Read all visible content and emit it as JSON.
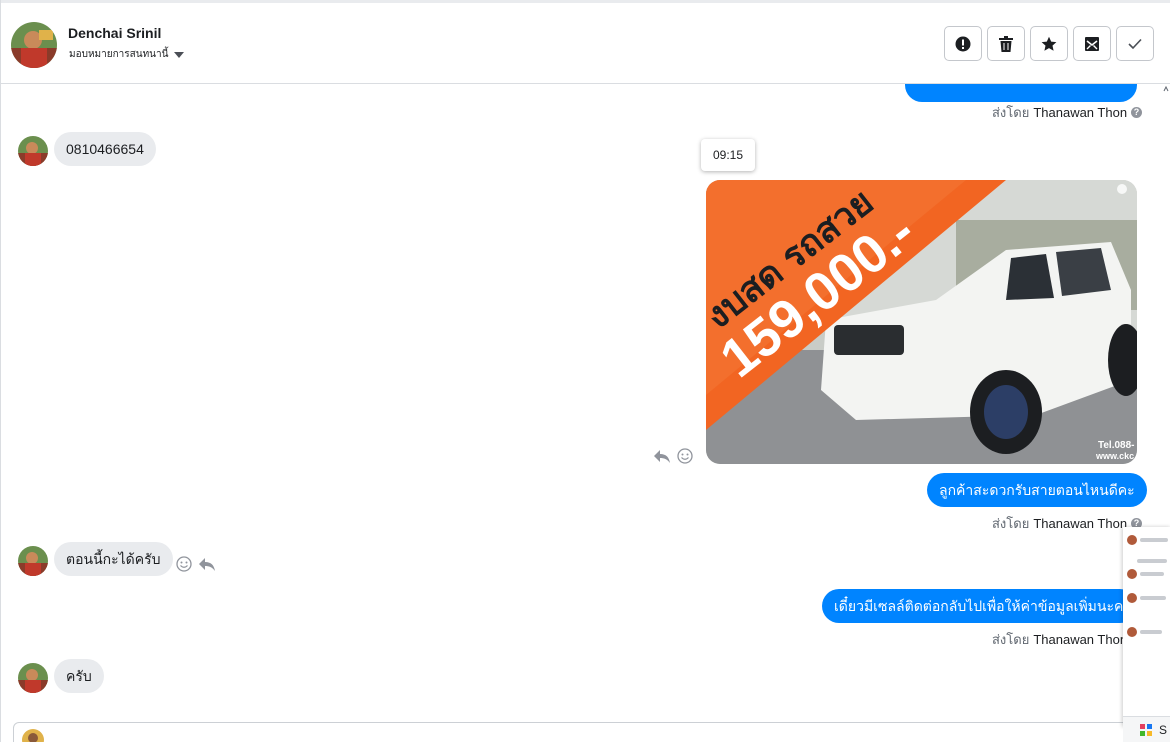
{
  "header": {
    "contact_name": "Denchai Srinil",
    "assign_label": "มอบหมายการสนทนานี้",
    "actions": [
      {
        "icon": "alert-icon",
        "name": "mark-spam-button"
      },
      {
        "icon": "trash-icon",
        "name": "delete-button"
      },
      {
        "icon": "star-icon",
        "name": "star-button"
      },
      {
        "icon": "mark-unread-icon",
        "name": "mark-unread-button"
      },
      {
        "icon": "check-icon",
        "name": "mark-done-button"
      }
    ]
  },
  "messages": {
    "sent_by_prefix": "ส่งโดย",
    "agent_name": "Thanawan Thon",
    "incoming_phone": "0810466654",
    "image_time": "09:15",
    "image_headline": "งบสด รถสวย",
    "image_price": "159,000.-",
    "image_tel": "Tel.088-",
    "image_web": "www.ckc",
    "outgoing_1": "ลูกค้าสะดวกรับสายตอนไหนดีคะ",
    "incoming_2": "ตอนนี้กะได้ครับ",
    "outgoing_2": "เดี๋ยวมีเซลล์ติดต่อกลับไปเพื่อให้ค่าข้อมูลเพิ่มนะคะ",
    "incoming_3": "ครับ"
  },
  "side_panel": {
    "footer_label": "S"
  },
  "colors": {
    "outgoing_bubble": "#0084ff",
    "incoming_bubble": "#e9ebee",
    "promo_orange": "#f26522"
  }
}
